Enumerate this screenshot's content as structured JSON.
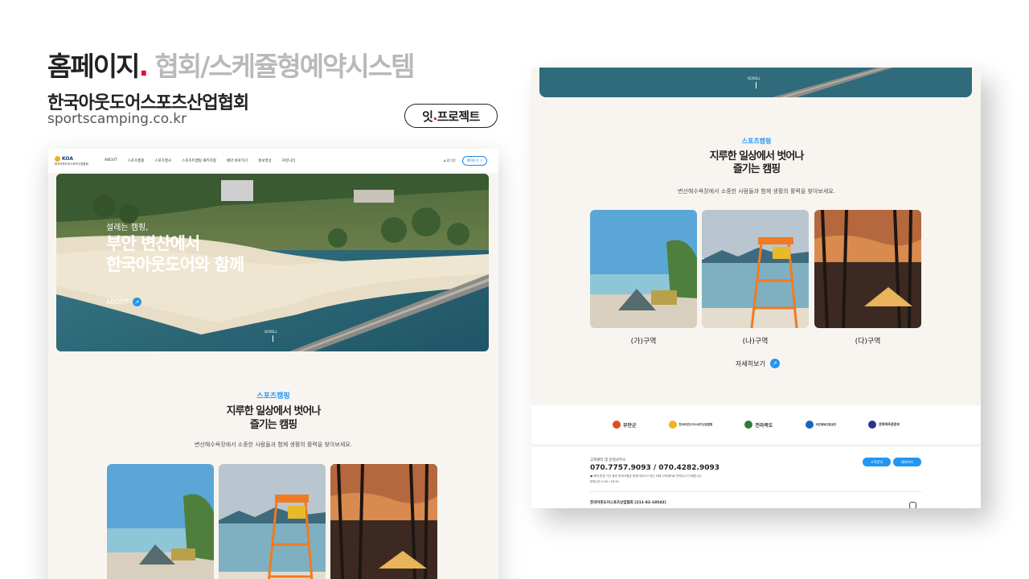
{
  "header": {
    "title_main": "홈페이지",
    "title_dot": ".",
    "title_sub": "협회/스케쥴형예약시스템",
    "client": "한국아웃도어스포츠산업협회",
    "url": "sportscamping.co.kr",
    "pill_a": "잇",
    "pill_dot": ".",
    "pill_b": "프로젝트"
  },
  "site": {
    "logo_mark": "KOA",
    "logo_text": "한국아웃도어스포츠산업협회",
    "menu": [
      "ABOUT",
      "스포츠캠핑",
      "스포츠행사",
      "스포츠트캠핑 패키지형",
      "예약 바로가기",
      "홍보영상",
      "커뮤니티"
    ],
    "login": "로그인",
    "reserve": "예약하기 ↗",
    "hero": {
      "small": "설레는 캠핑,",
      "big_line1": "부안 변산에서",
      "big_line2": "한국아웃도어와 함께",
      "about": "ABOUT",
      "scroll": "SCROLL"
    },
    "section": {
      "tag": "스포츠캠핑",
      "title_line1": "지루한 일상에서 벗어나",
      "title_line2": "즐기는 캠핑",
      "desc": "변산해수욕장에서 소중한 사람들과 함께 생활의 활력을 찾아보세요."
    },
    "cards": [
      "(가)구역",
      "(나)구역",
      "(다)구역"
    ],
    "more": "자세히보기",
    "partners": [
      "부안군",
      "한국아웃도어스포츠산업협회",
      "전라북도",
      "국민체육진흥공단",
      "문화체육관광부"
    ],
    "footer": {
      "label": "고객센터 및 운영사무소",
      "tel": "070.7757.9093 / 070.4282.9093",
      "note1": "● 예약 운영 기간 동안 문의사항은 운영사무소가 아닌 아래 고객센터로 연락주시기 바랍니다.",
      "note2": "운영시간 9:30~18:30",
      "btn1": "고객문의",
      "btn2": "예약하기",
      "company": "한국아웃도어스포츠산업협회 [211-82-18542]"
    }
  },
  "colors": {
    "accent": "#2196f3",
    "dot": "#e00033",
    "muted_title": "#b9b9b9",
    "page_bg": "#f8f5f1"
  }
}
